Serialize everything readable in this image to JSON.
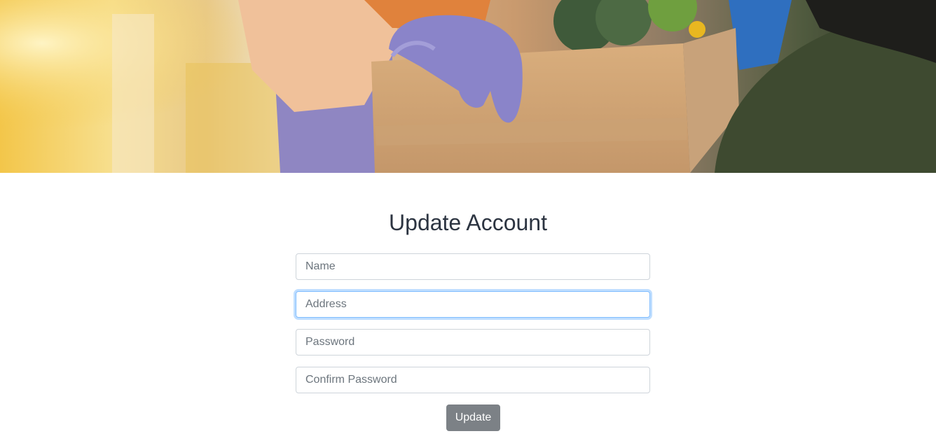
{
  "form": {
    "title": "Update Account",
    "fields": [
      {
        "placeholder": "Name",
        "value": ""
      },
      {
        "placeholder": "Address",
        "value": ""
      },
      {
        "placeholder": "Password",
        "value": ""
      },
      {
        "placeholder": "Confirm Password",
        "value": ""
      }
    ],
    "submit_label": "Update"
  },
  "colors": {
    "title": "#2c3441",
    "button": "#7c8186",
    "focus_border": "#80bdff"
  }
}
